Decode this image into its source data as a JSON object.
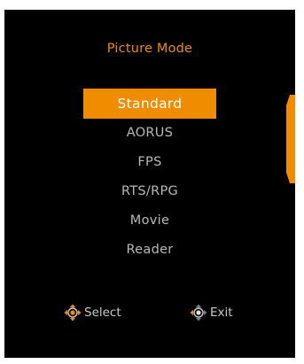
{
  "colors": {
    "panel_background": "#000000",
    "accent": "#f08c00",
    "selected_text": "#ffffff",
    "item_text": "#b9b9b9",
    "hint_text": "#c8c8c8"
  },
  "osd": {
    "title": "Picture Mode",
    "modes": [
      {
        "label": "Standard",
        "selected": true
      },
      {
        "label": "AORUS",
        "selected": false
      },
      {
        "label": "FPS",
        "selected": false
      },
      {
        "label": "RTS/RPG",
        "selected": false
      },
      {
        "label": "Movie",
        "selected": false
      },
      {
        "label": "Reader",
        "selected": false
      }
    ],
    "hints": {
      "select": {
        "label": "Select",
        "icon": "joystick-select-icon"
      },
      "exit": {
        "label": "Exit",
        "icon": "joystick-exit-icon"
      }
    }
  }
}
